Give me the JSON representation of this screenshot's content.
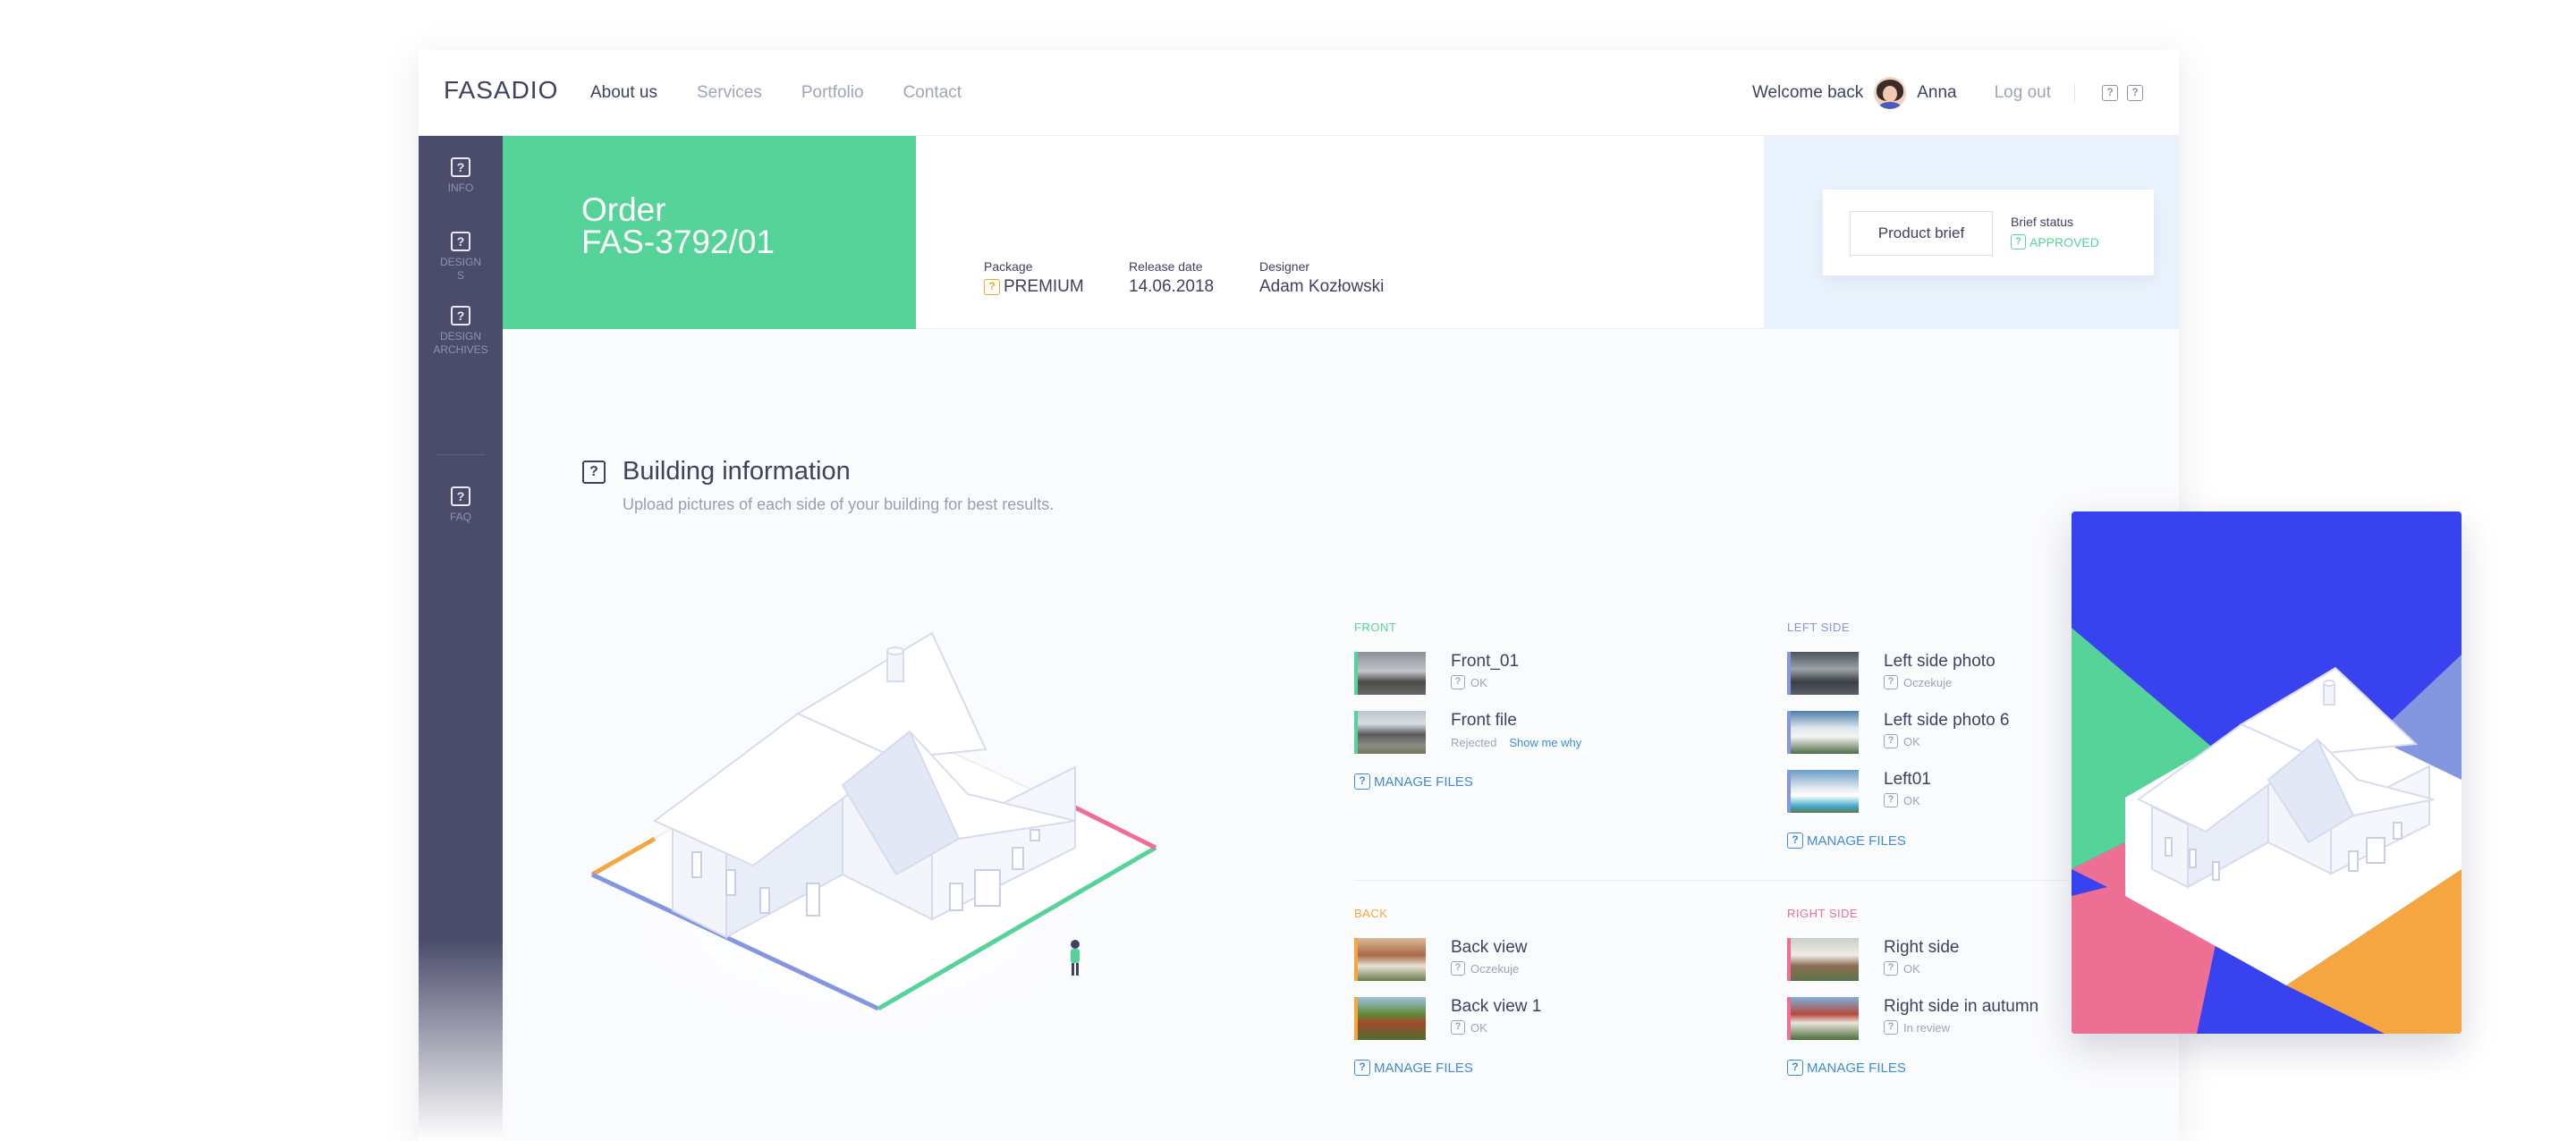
{
  "brand": "FASADIO",
  "nav": [
    {
      "label": "About us",
      "active": true
    },
    {
      "label": "Services",
      "active": false
    },
    {
      "label": "Portfolio",
      "active": false
    },
    {
      "label": "Contact",
      "active": false
    }
  ],
  "user": {
    "welcome": "Welcome back",
    "name": "Anna",
    "logout": "Log out"
  },
  "sidebar": [
    {
      "label": "INFO",
      "icon": "info-icon"
    },
    {
      "label": "DESIGNS",
      "icon": "designs-icon"
    },
    {
      "label": "DESIGN ARCHIVES",
      "icon": "archive-icon"
    },
    {
      "label": "FAQ",
      "icon": "faq-icon"
    }
  ],
  "order": {
    "line1": "Order",
    "line2": "FAS-3792/01"
  },
  "meta": {
    "package_label": "Package",
    "package_value": "PREMIUM",
    "release_label": "Release date",
    "release_value": "14.06.2018",
    "designer_label": "Designer",
    "designer_value": "Adam Kozłowski"
  },
  "brief": {
    "button": "Product brief",
    "status_label": "Brief status",
    "status_value": "APPROVED"
  },
  "section": {
    "title": "Building information",
    "subtitle": "Upload pictures of each side of your building for best results."
  },
  "groups": {
    "front": {
      "title": "FRONT",
      "files": [
        {
          "name": "Front_01",
          "status": "OK",
          "note": ""
        },
        {
          "name": "Front file",
          "status": "Rejected",
          "note": "Show me why"
        }
      ],
      "manage": "MANAGE FILES"
    },
    "left": {
      "title": "LEFT SIDE",
      "files": [
        {
          "name": "Left side photo",
          "status": "Oczekuje",
          "note": ""
        },
        {
          "name": "Left side photo 6",
          "status": "OK",
          "note": ""
        },
        {
          "name": "Left01",
          "status": "OK",
          "note": ""
        }
      ],
      "manage": "MANAGE FILES"
    },
    "back": {
      "title": "BACK",
      "files": [
        {
          "name": "Back view",
          "status": "Oczekuje",
          "note": ""
        },
        {
          "name": "Back view 1",
          "status": "OK",
          "note": ""
        }
      ],
      "manage": "MANAGE FILES"
    },
    "right": {
      "title": "RIGHT SIDE",
      "files": [
        {
          "name": "Right side",
          "status": "OK",
          "note": ""
        },
        {
          "name": "Right side in autumn",
          "status": "In review",
          "note": ""
        }
      ],
      "manage": "MANAGE FILES"
    }
  },
  "colors": {
    "green": "#56d399",
    "orange": "#f5a640",
    "blue": "#8496e0",
    "pink": "#ee6f94",
    "royal": "#3842ee",
    "sidebar": "#4b4c6b",
    "link": "#3d8bd9",
    "brief_bg": "#eaf3fd"
  }
}
